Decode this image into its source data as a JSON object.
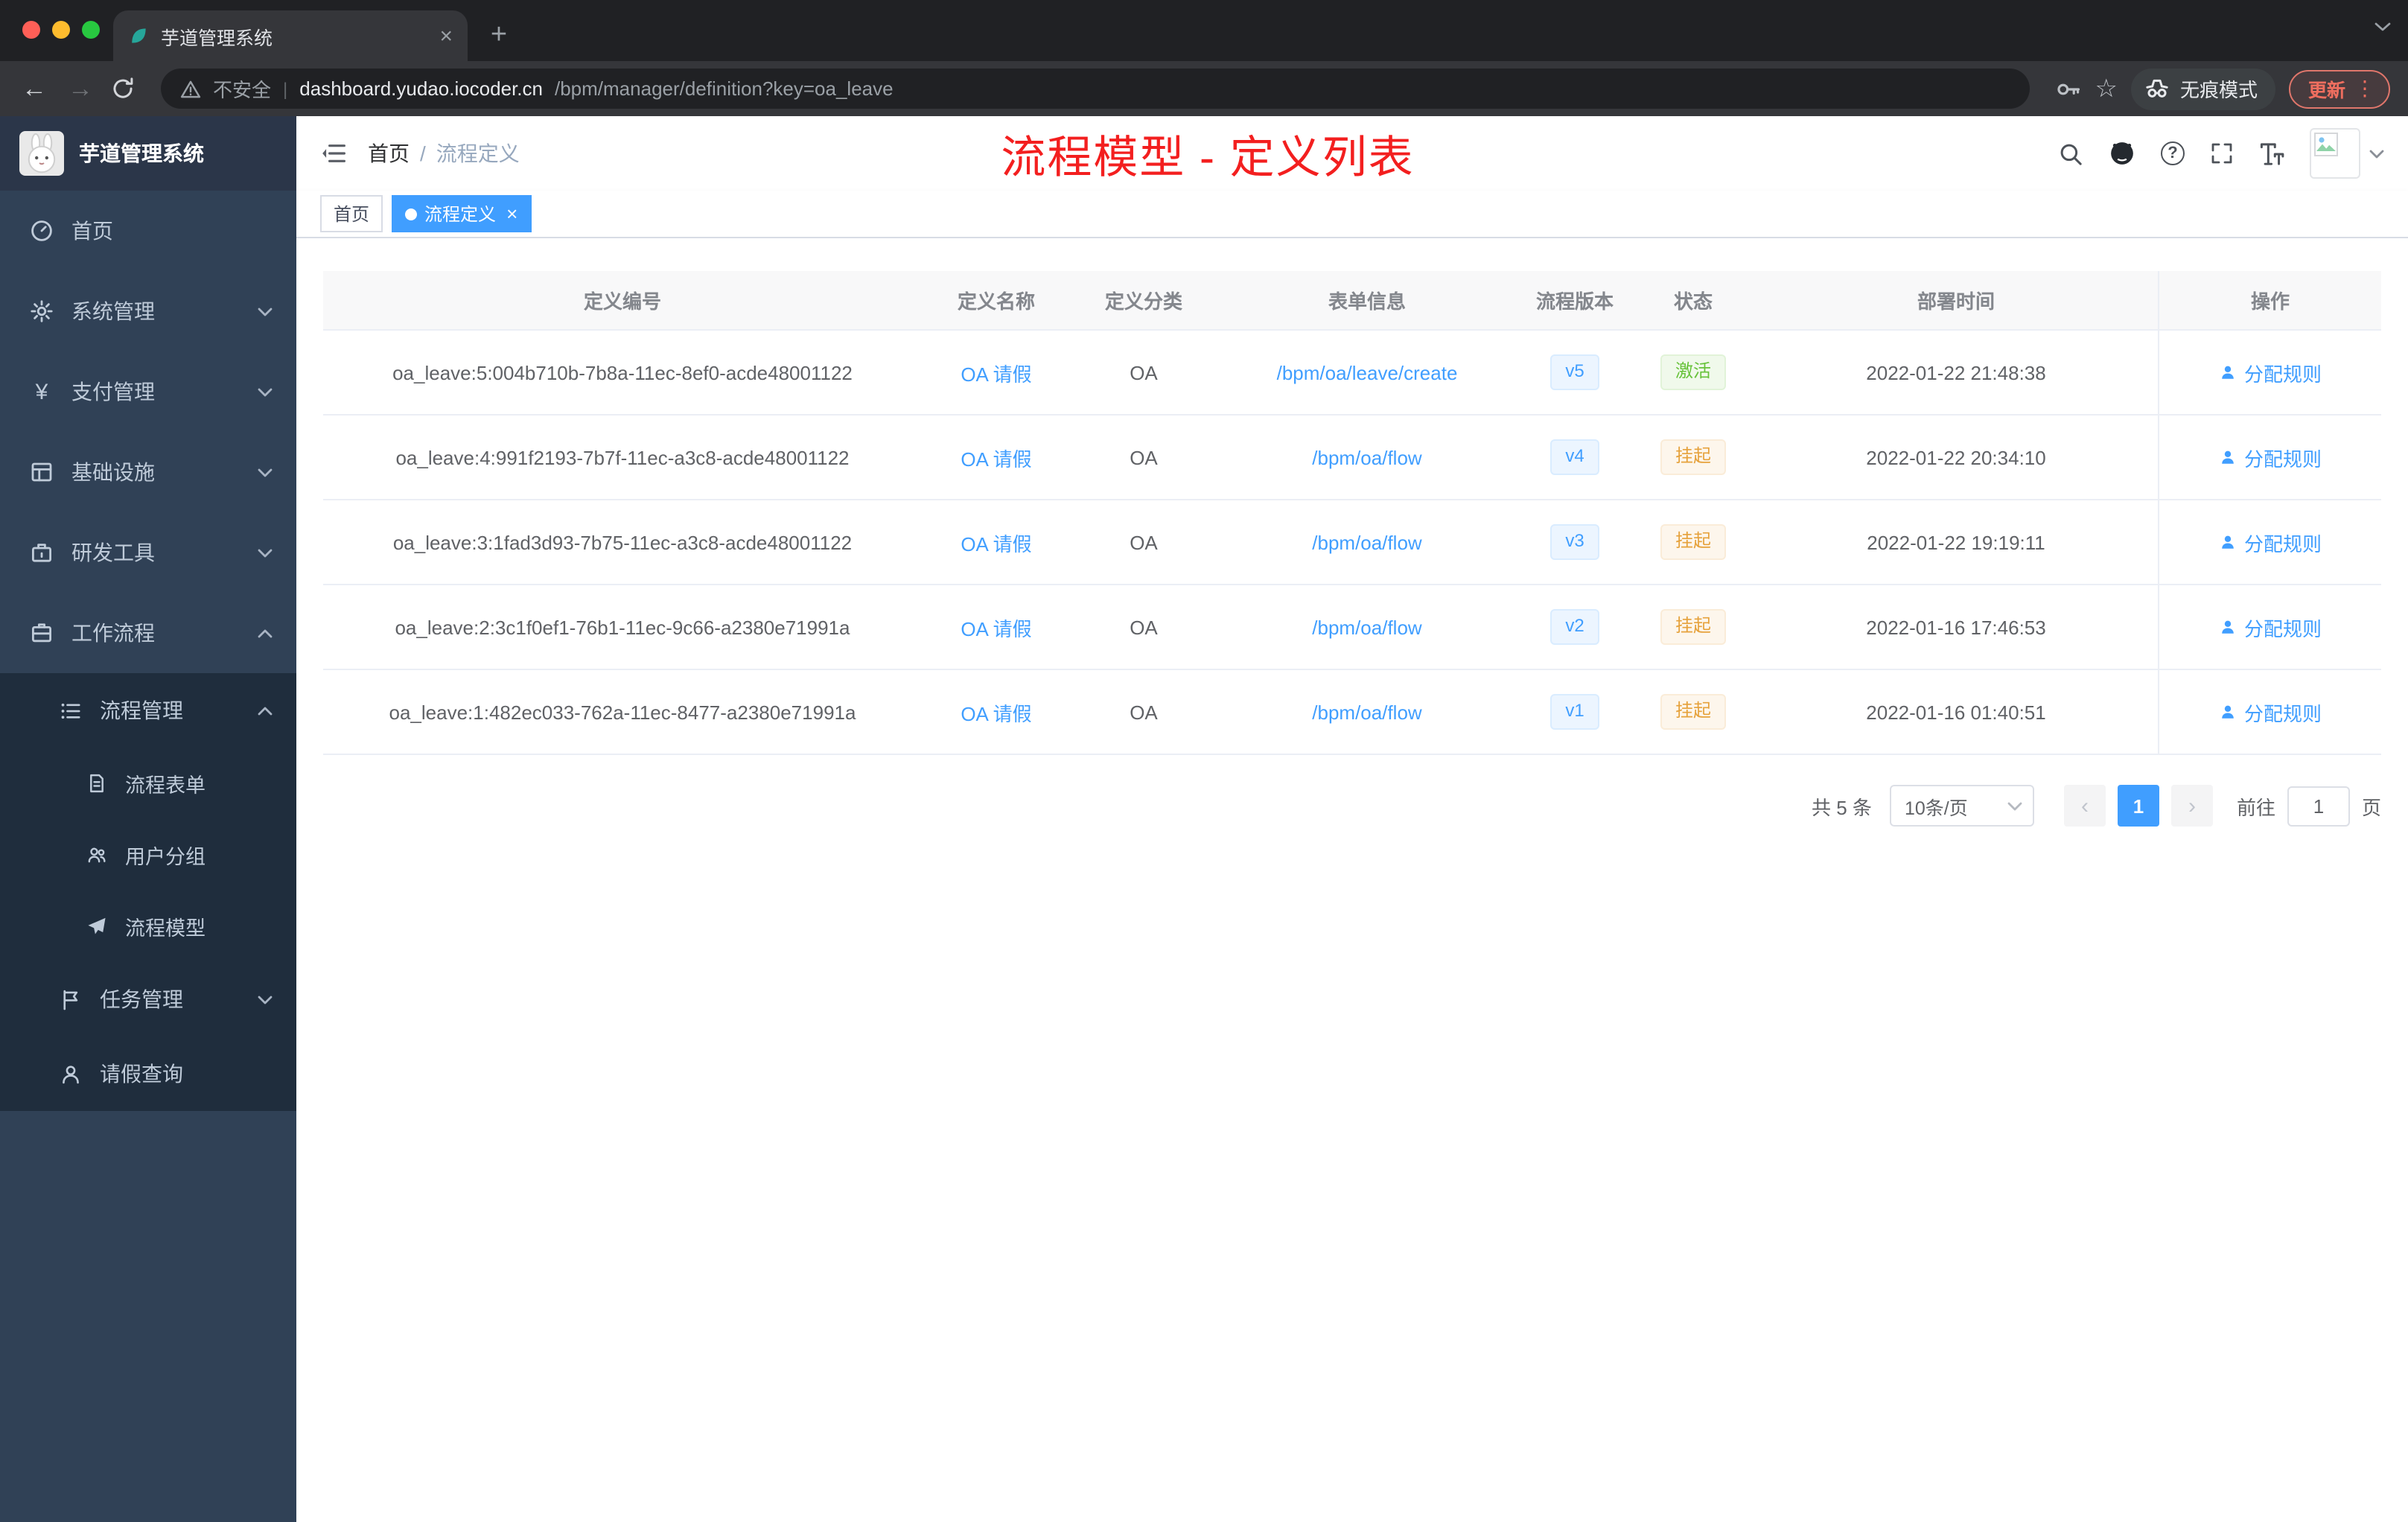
{
  "icons": {
    "close": "×",
    "plus": "+",
    "back": "←",
    "forward": "→",
    "divider": "|",
    "star": "☆",
    "more": "⋮",
    "question": "?",
    "prev": "‹",
    "next": "›",
    "yen": "¥"
  },
  "browser": {
    "tab_title": "芋道管理系统",
    "security_label": "不安全",
    "url_host": "dashboard.yudao.iocoder.cn",
    "url_path": "/bpm/manager/definition?key=oa_leave",
    "incognito_label": "无痕模式",
    "update_label": "更新"
  },
  "sidebar": {
    "logo_title": "芋道管理系统",
    "items": [
      {
        "label": "首页"
      },
      {
        "label": "系统管理"
      },
      {
        "label": "支付管理"
      },
      {
        "label": "基础设施"
      },
      {
        "label": "研发工具"
      },
      {
        "label": "工作流程"
      }
    ],
    "submenu": {
      "process_mgmt_label": "流程管理",
      "process_children": [
        {
          "label": "流程表单"
        },
        {
          "label": "用户分组"
        },
        {
          "label": "流程模型"
        }
      ],
      "task_mgmt_label": "任务管理",
      "leave_query_label": "请假查询"
    }
  },
  "header": {
    "breadcrumb_home": "首页",
    "breadcrumb_separator": "/",
    "breadcrumb_current": "流程定义",
    "annotation": "流程模型 - 定义列表"
  },
  "tags": {
    "home": "首页",
    "active": "流程定义"
  },
  "table": {
    "columns": [
      "定义编号",
      "定义名称",
      "定义分类",
      "表单信息",
      "流程版本",
      "状态",
      "部署时间",
      "操作"
    ],
    "rows": [
      {
        "id": "oa_leave:5:004b710b-7b8a-11ec-8ef0-acde48001122",
        "name": "OA 请假",
        "category": "OA",
        "form": "/bpm/oa/leave/create",
        "version": "v5",
        "status": "激活",
        "time": "2022-01-22 21:48:38",
        "action": "分配规则"
      },
      {
        "id": "oa_leave:4:991f2193-7b7f-11ec-a3c8-acde48001122",
        "name": "OA 请假",
        "category": "OA",
        "form": "/bpm/oa/flow",
        "version": "v4",
        "status": "挂起",
        "time": "2022-01-22 20:34:10",
        "action": "分配规则"
      },
      {
        "id": "oa_leave:3:1fad3d93-7b75-11ec-a3c8-acde48001122",
        "name": "OA 请假",
        "category": "OA",
        "form": "/bpm/oa/flow",
        "version": "v3",
        "status": "挂起",
        "time": "2022-01-22 19:19:11",
        "action": "分配规则"
      },
      {
        "id": "oa_leave:2:3c1f0ef1-76b1-11ec-9c66-a2380e71991a",
        "name": "OA 请假",
        "category": "OA",
        "form": "/bpm/oa/flow",
        "version": "v2",
        "status": "挂起",
        "time": "2022-01-16 17:46:53",
        "action": "分配规则"
      },
      {
        "id": "oa_leave:1:482ec033-762a-11ec-8477-a2380e71991a",
        "name": "OA 请假",
        "category": "OA",
        "form": "/bpm/oa/flow",
        "version": "v1",
        "status": "挂起",
        "time": "2022-01-16 01:40:51",
        "action": "分配规则"
      }
    ]
  },
  "pagination": {
    "total_label": "共 5 条",
    "page_size_label": "10条/页",
    "current_page": "1",
    "goto_label": "前往",
    "goto_value": "1",
    "page_unit_label": "页"
  },
  "colors": {
    "accent_blue": "#409eff",
    "success_green": "#67c23a",
    "warning_orange": "#e6a23c",
    "annotation_red": "#f31f1f",
    "sidebar_bg": "#304156",
    "submenu_bg": "#1f2d3d"
  }
}
